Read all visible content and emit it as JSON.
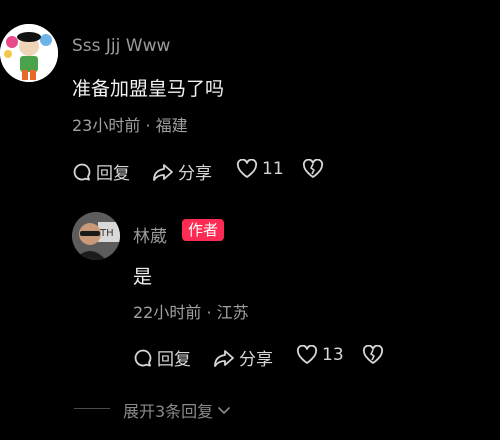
{
  "comment": {
    "username": "Sss Jjj Www",
    "text": "准备加盟皇马了吗",
    "meta": "23小时前 · 福建",
    "reply_label": "回复",
    "share_label": "分享",
    "like_count": "11"
  },
  "reply": {
    "username": "林葳",
    "badge": "作者",
    "text": "是",
    "meta": "22小时前 · 江苏",
    "reply_label": "回复",
    "share_label": "分享",
    "like_count": "13"
  },
  "expand": {
    "label": "展开3条回复"
  },
  "colors": {
    "background": "#000000",
    "badge": "#fe2c55",
    "text_primary": "#f2f2f2",
    "text_secondary": "#a0a0a0"
  },
  "icons": [
    "reply-bubble-icon",
    "share-arrow-icon",
    "heart-icon",
    "broken-heart-icon",
    "chevron-down-icon"
  ]
}
